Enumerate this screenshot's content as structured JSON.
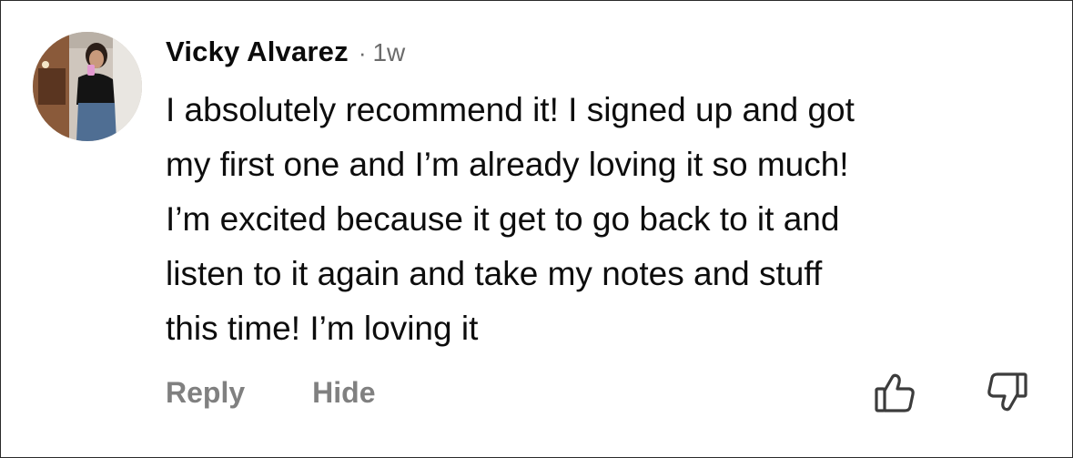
{
  "comment": {
    "author": "Vicky Alvarez",
    "separator": "·",
    "timestamp": "1w",
    "lines": [
      "I absolutely recommend it! I signed up and got",
      "my first one and I’m already loving it so much!",
      "I’m excited because it get to go back to it and",
      "listen to it again and take my notes and stuff",
      "this time! I’m loving it"
    ]
  },
  "actions": {
    "reply_label": "Reply",
    "hide_label": "Hide"
  },
  "icons": {
    "upvote": "thumbs-up-icon",
    "downvote": "thumbs-down-icon"
  },
  "colors": {
    "text": "#0d0d0d",
    "muted": "#808080",
    "background": "#ffffff"
  }
}
